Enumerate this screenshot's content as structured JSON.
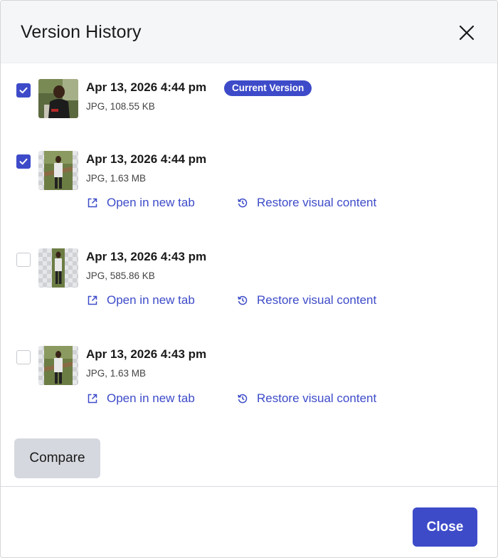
{
  "dialog": {
    "title": "Version History",
    "close_icon": "close-icon"
  },
  "versions": [
    {
      "date": "Apr 13, 2026 4:44 pm",
      "meta": "JPG, 108.55 KB",
      "checked": true,
      "badge": "Current Version"
    },
    {
      "date": "Apr 13, 2026 4:44 pm",
      "meta": "JPG, 1.63 MB",
      "checked": true,
      "open_label": "Open in new tab",
      "restore_label": "Restore visual content"
    },
    {
      "date": "Apr 13, 2026 4:43 pm",
      "meta": "JPG, 585.86 KB",
      "checked": false,
      "open_label": "Open in new tab",
      "restore_label": "Restore visual content"
    },
    {
      "date": "Apr 13, 2026 4:43 pm",
      "meta": "JPG, 1.63 MB",
      "checked": false,
      "open_label": "Open in new tab",
      "restore_label": "Restore visual content"
    }
  ],
  "footer": {
    "compare_label": "Compare",
    "close_label": "Close"
  },
  "colors": {
    "accent": "#3d4bc9",
    "header_bg": "#f5f6f8",
    "compare_bg": "#d5d8de"
  }
}
